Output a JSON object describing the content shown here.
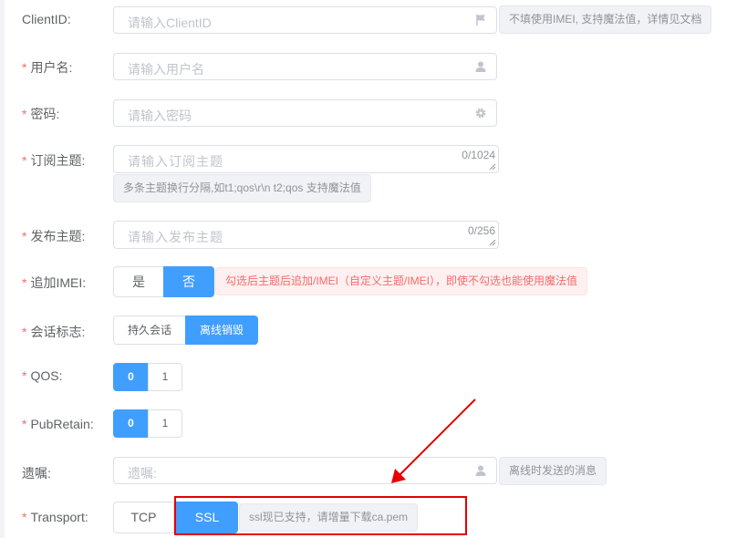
{
  "form": {
    "clientid": {
      "label": "ClientID:",
      "placeholder": "请输入ClientID",
      "tip": "不填使用IMEI, 支持魔法值，详情见文档"
    },
    "username": {
      "required_mark": "*",
      "label": "用户名:",
      "placeholder": "请输入用户名"
    },
    "password": {
      "required_mark": "*",
      "label": "密码:",
      "placeholder": "请输入密码"
    },
    "subscribe": {
      "required_mark": "*",
      "label": "订阅主题:",
      "placeholder": "请输入订阅主题",
      "counter": "0/1024",
      "tip": "多条主题换行分隔,如t1;qos\\r\\n t2;qos 支持魔法值"
    },
    "publish": {
      "required_mark": "*",
      "label": "发布主题:",
      "placeholder": "请输入发布主题",
      "counter": "0/256"
    },
    "append_imei": {
      "required_mark": "*",
      "label": "追加IMEI:",
      "options": [
        "是",
        "否"
      ],
      "selected": "否",
      "tip": "勾选后主题后追加/IMEI（自定义主题/IMEI），即使不勾选也能使用魔法值"
    },
    "session": {
      "required_mark": "*",
      "label": "会话标志:",
      "options": [
        "持久会话",
        "离线销毁"
      ],
      "selected": "离线销毁"
    },
    "qos": {
      "required_mark": "*",
      "label": "QOS:",
      "options": [
        "0",
        "1"
      ],
      "selected": "0"
    },
    "pub_retain": {
      "required_mark": "*",
      "label": "PubRetain:",
      "options": [
        "0",
        "1"
      ],
      "selected": "0"
    },
    "will": {
      "label": "遗嘱:",
      "placeholder": "遗嘱:",
      "tip": "离线时发送的消息"
    },
    "transport": {
      "required_mark": "*",
      "label": "Transport:",
      "options": [
        "TCP",
        "SSL"
      ],
      "selected": "SSL",
      "tip": "ssl现已支持，请增量下载ca.pem"
    }
  },
  "colors": {
    "primary": "#409eff",
    "required": "#f56c6c",
    "annotation": "#e60000"
  },
  "icons": {
    "clientid": "flag-icon",
    "username": "user-icon",
    "password": "gear-icon",
    "will": "user-icon"
  }
}
